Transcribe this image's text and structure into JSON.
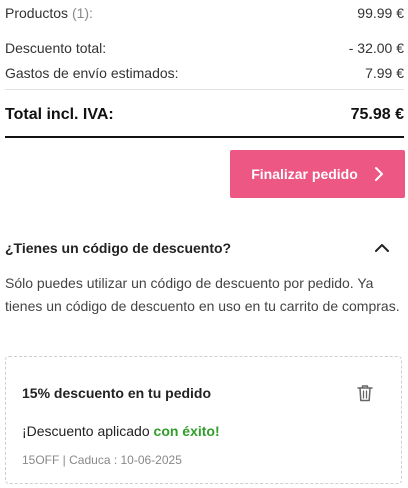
{
  "summary": {
    "products_label": "Productos",
    "products_count": "(1):",
    "products_value": "99.99 €",
    "discount_label": "Descuento total:",
    "discount_value": "- 32.00 €",
    "shipping_label": "Gastos de envío estimados:",
    "shipping_value": "7.99 €",
    "total_label": "Total incl. IVA:",
    "total_value": "75.98 €"
  },
  "checkout": {
    "button_label": "Finalizar pedido",
    "button_color": "#ec5784"
  },
  "coupon": {
    "header": "¿Tienes un código de descuento?",
    "description": "Sólo puedes utilizar un código de descuento por pedido. Ya tienes un código de descuento en uso en tu carrito de compras.",
    "card": {
      "title": "15% descuento en tu pedido",
      "status_prefix": "¡Descuento aplicado ",
      "status_success": "con éxito!",
      "meta": "15OFF | Caduca : 10-06-2025",
      "success_color": "#2f9e2a"
    }
  },
  "icons": [
    "chevron-right-icon",
    "chevron-up-icon",
    "trash-icon"
  ]
}
